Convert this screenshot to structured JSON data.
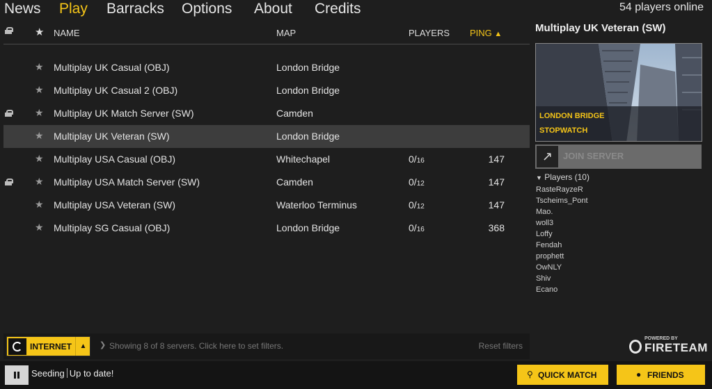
{
  "nav": {
    "items": [
      "News",
      "Play",
      "Barracks",
      "Options",
      "About",
      "Credits"
    ],
    "active": "Play",
    "players_online": "54 players online"
  },
  "server_list": {
    "columns": {
      "name": "NAME",
      "map": "MAP",
      "players": "PLAYERS",
      "ping": "PING"
    },
    "sort": {
      "column": "PING",
      "direction": "ascending"
    },
    "rows": [
      {
        "locked": false,
        "name": "Multiplay UK Casual (OBJ)",
        "map": "London Bridge",
        "players": "",
        "max": "",
        "ping": "",
        "selected": false
      },
      {
        "locked": false,
        "name": "Multiplay UK Casual 2 (OBJ)",
        "map": "London Bridge",
        "players": "",
        "max": "",
        "ping": "",
        "selected": false
      },
      {
        "locked": true,
        "name": "Multiplay UK Match Server (SW)",
        "map": "Camden",
        "players": "",
        "max": "",
        "ping": "",
        "selected": false
      },
      {
        "locked": false,
        "name": "Multiplay UK Veteran (SW)",
        "map": "London Bridge",
        "players": "",
        "max": "",
        "ping": "",
        "selected": true
      },
      {
        "locked": false,
        "name": "Multiplay USA Casual (OBJ)",
        "map": "Whitechapel",
        "players": "0/",
        "max": "16",
        "ping": "147",
        "selected": false
      },
      {
        "locked": true,
        "name": "Multiplay USA Match Server (SW)",
        "map": "Camden",
        "players": "0/",
        "max": "12",
        "ping": "147",
        "selected": false
      },
      {
        "locked": false,
        "name": "Multiplay USA Veteran (SW)",
        "map": "Waterloo Terminus",
        "players": "0/",
        "max": "12",
        "ping": "147",
        "selected": false
      },
      {
        "locked": false,
        "name": "Multiplay SG Casual (OBJ)",
        "map": "London Bridge",
        "players": "0/",
        "max": "16",
        "ping": "368",
        "selected": false
      }
    ]
  },
  "filterbar": {
    "source_label": "INTERNET",
    "status": "Showing 8 of 8 servers. Click here to set filters.",
    "reset_label": "Reset filters"
  },
  "detail": {
    "title": "Multiplay UK Veteran (SW)",
    "map_name": "LONDON BRIDGE",
    "mode": "STOPWATCH",
    "join_label": "JOIN SERVER",
    "players_heading": "Players (10)",
    "players": [
      "RasteRayzeR",
      "Tscheims_Pont",
      "Mao.",
      "woll3",
      "Loffy",
      "Fendah",
      "prophett",
      "OwNLY",
      "Shiv",
      "Ecano"
    ]
  },
  "branding": {
    "powered_by": "POWERED BY",
    "name": "FIRETEAM"
  },
  "statusbar": {
    "seeding": "Seeding",
    "update": "Up to date!",
    "quick_match_label": "QUICK MATCH",
    "friends_label": "FRIENDS"
  },
  "colors": {
    "accent": "#f5c518",
    "background": "#1e1e1e",
    "selected_row": "#3d3d3d"
  }
}
